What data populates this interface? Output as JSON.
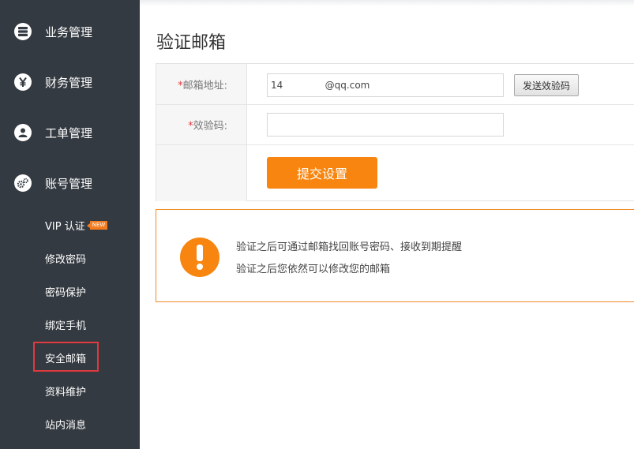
{
  "sidebar": {
    "nav": [
      {
        "label": "业务管理",
        "icon": "server-icon"
      },
      {
        "label": "财务管理",
        "icon": "yen-icon"
      },
      {
        "label": "工单管理",
        "icon": "user-icon"
      },
      {
        "label": "账号管理",
        "icon": "gears-icon"
      }
    ],
    "sub_items": [
      {
        "label": "VIP 认证",
        "badge": "NEW"
      },
      {
        "label": "修改密码"
      },
      {
        "label": "密码保护"
      },
      {
        "label": "绑定手机"
      },
      {
        "label": "安全邮箱"
      },
      {
        "label": "资料维护"
      },
      {
        "label": "站内消息"
      }
    ],
    "active_sub_item": "安全邮箱"
  },
  "main": {
    "title": "验证邮箱",
    "form": {
      "email_label": "邮箱地址:",
      "email_value": "14              @qq.com",
      "send_button": "发送效验码",
      "code_label": "效验码:",
      "code_value": "",
      "required_mark": "*",
      "submit_button": "提交设置"
    },
    "notice": {
      "line1": "验证之后可通过邮箱找回账号密码、接收到期提醒",
      "line2": "验证之后您依然可以修改您的邮箱"
    }
  },
  "colors": {
    "sidebar_bg": "#343a41",
    "accent_orange": "#f7850f",
    "active_outline": "#e0393e"
  }
}
